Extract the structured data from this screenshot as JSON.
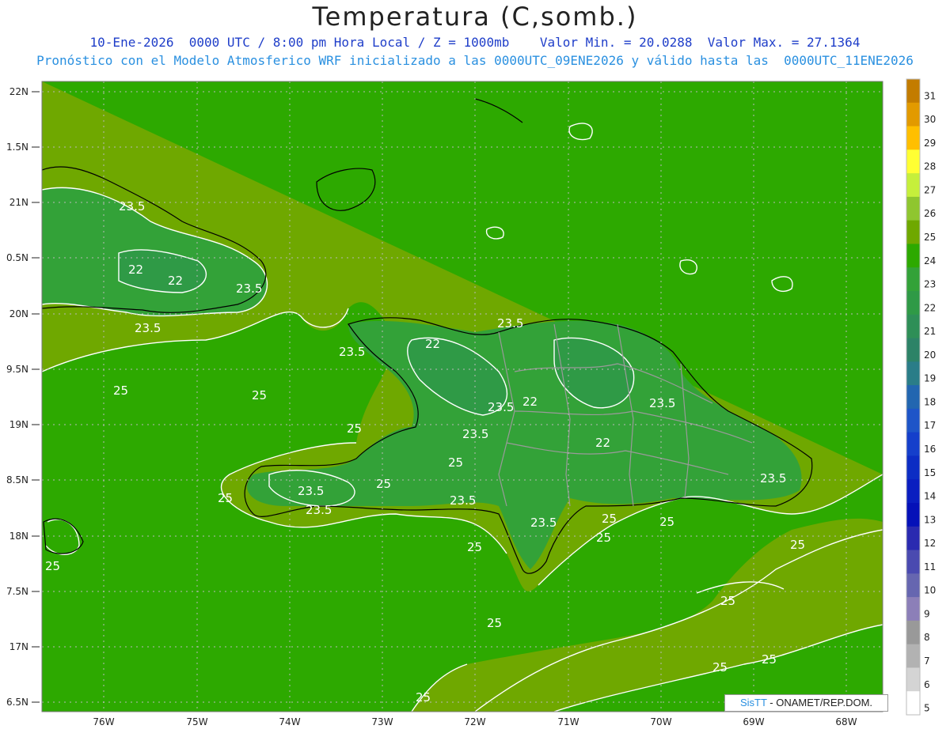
{
  "header": {
    "title": "Temperatura (C,somb.)",
    "subtitle_line1": "10-Ene-2026  0000 UTC / 8:00 pm Hora Local / Z = 1000mb    Valor Min. = 20.0288  Valor Max. = 27.1364",
    "subtitle_line2": "Pronóstico con el Modelo Atmosferico WRF inicializado a las 0000UTC_09ENE2026 y válido hasta las  0000UTC_11ENE2026"
  },
  "axes": {
    "lat_labels": [
      "22N",
      "1.5N",
      "21N",
      "0.5N",
      "20N",
      "9.5N",
      "19N",
      "8.5N",
      "18N",
      "7.5N",
      "17N",
      "6.5N"
    ],
    "lon_labels": [
      "76W",
      "75W",
      "74W",
      "73W",
      "72W",
      "71W",
      "70W",
      "69W",
      "68W"
    ]
  },
  "colorbar": {
    "labels": [
      "31",
      "30",
      "29",
      "28",
      "27",
      "26",
      "25",
      "24",
      "23",
      "22",
      "21",
      "20",
      "19",
      "18",
      "17",
      "16",
      "15",
      "14",
      "13",
      "12",
      "11",
      "10",
      "9",
      "8",
      "7",
      "6",
      "5"
    ],
    "colors": [
      "#c37c00",
      "#e29a00",
      "#ffbf00",
      "#ffff33",
      "#c6ef3b",
      "#8fc62f",
      "#6fa800",
      "#2da900",
      "#33a238",
      "#2f9a46",
      "#2e8f57",
      "#2d8367",
      "#2a7d88",
      "#2266b0",
      "#1e55c8",
      "#153fcb",
      "#0c2dc4",
      "#0a1ec0",
      "#0511b8",
      "#2a2ab0",
      "#4a4ab0",
      "#6666b0",
      "#8c7fb8",
      "#999999",
      "#b2b2b2",
      "#d4d4d4",
      "#ffffff"
    ]
  },
  "contour_labels": [
    "23.5",
    "22",
    "22",
    "23.5",
    "23.5",
    "25",
    "25",
    "23.5",
    "22",
    "23.5",
    "23.5",
    "22",
    "22",
    "23.5",
    "25",
    "25",
    "23.5",
    "23.5",
    "25",
    "25",
    "23.5",
    "25",
    "25",
    "23.5",
    "25",
    "25",
    "25",
    "25",
    "25",
    "25",
    "23.5",
    "25",
    "25",
    "25"
  ],
  "credit": {
    "brand": "SisTT",
    "text": " - ONAMET/REP.DOM."
  },
  "colors": {
    "sea_green": "#6fa800",
    "warm_green": "#2da900",
    "cool_green": "#33a238",
    "coastline": "#000000",
    "contour": "#ffffff",
    "border": "#999999"
  }
}
